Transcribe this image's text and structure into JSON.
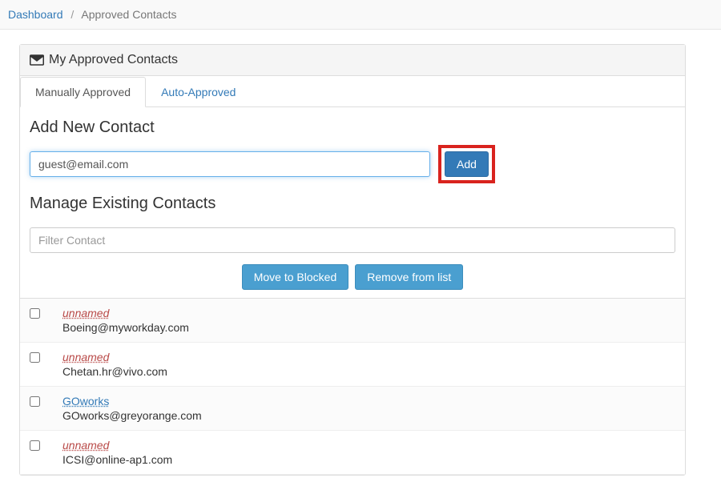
{
  "breadcrumb": {
    "root": "Dashboard",
    "current": "Approved Contacts"
  },
  "panel": {
    "title": "My Approved Contacts"
  },
  "tabs": {
    "manual": "Manually Approved",
    "auto": "Auto-Approved"
  },
  "add_section": {
    "title": "Add New Contact",
    "input_value": "guest@email.com",
    "add_label": "Add"
  },
  "manage_section": {
    "title": "Manage Existing Contacts",
    "filter_placeholder": "Filter Contact",
    "move_blocked_label": "Move to Blocked",
    "remove_label": "Remove from list"
  },
  "contacts": [
    {
      "name": "unnamed",
      "name_style": "unnamed",
      "email": "Boeing@myworkday.com"
    },
    {
      "name": "unnamed",
      "name_style": "unnamed",
      "email": "Chetan.hr@vivo.com"
    },
    {
      "name": "GOworks",
      "name_style": "link",
      "email": "GOworks@greyorange.com"
    },
    {
      "name": "unnamed",
      "name_style": "unnamed",
      "email": "ICSI@online-ap1.com"
    }
  ]
}
